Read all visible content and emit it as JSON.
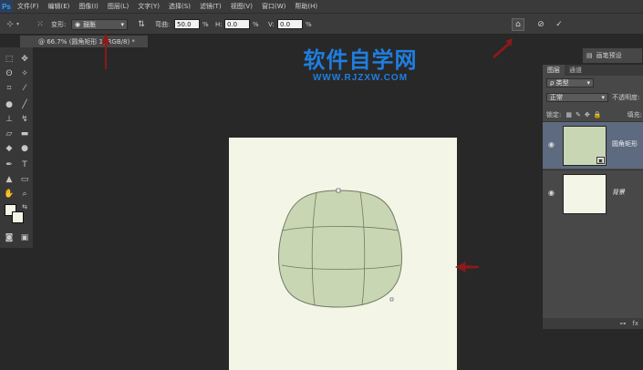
{
  "app": {
    "logo": "Ps"
  },
  "menu": [
    "文件(F)",
    "编辑(E)",
    "图像(I)",
    "图层(L)",
    "文字(Y)",
    "选择(S)",
    "滤镜(T)",
    "视图(V)",
    "窗口(W)",
    "帮助(H)"
  ],
  "options": {
    "warp_label": "变形:",
    "warp_value": "鼓胀",
    "bend_label": "弯曲:",
    "bend_value": "50.0",
    "h_label": "H:",
    "h_value": "0.0",
    "v_label": "V:",
    "v_value": "0.0",
    "percent": "%"
  },
  "document": {
    "tab_title": "@ 66.7% (圆角矩形 1, RGB/8) *"
  },
  "watermark": {
    "title": "软件自学网",
    "url": "WWW.RJZXW.COM"
  },
  "panels": {
    "brush_preset": "画笔预设",
    "tabs": [
      "图层",
      "通道"
    ],
    "kind_label": "ρ 类型",
    "blend_mode": "正常",
    "opacity_label": "不透明度:",
    "lock_label": "锁定:",
    "fill_label": "填充:",
    "layers": [
      {
        "name": "圆角矩形",
        "selected": true,
        "thumb_color": "#c9d6b4"
      },
      {
        "name": "背景",
        "selected": false,
        "thumb_color": "#f3f6e6"
      }
    ],
    "footer_icons": [
      "link-icon",
      "fx-icon"
    ],
    "footer_fx": "fx"
  },
  "colors": {
    "accent_blue": "#1f7ee0",
    "canvas_bg": "#f3f6e6",
    "shape_fill": "#c9d6b4",
    "arrow_red": "#8b1a1a"
  }
}
